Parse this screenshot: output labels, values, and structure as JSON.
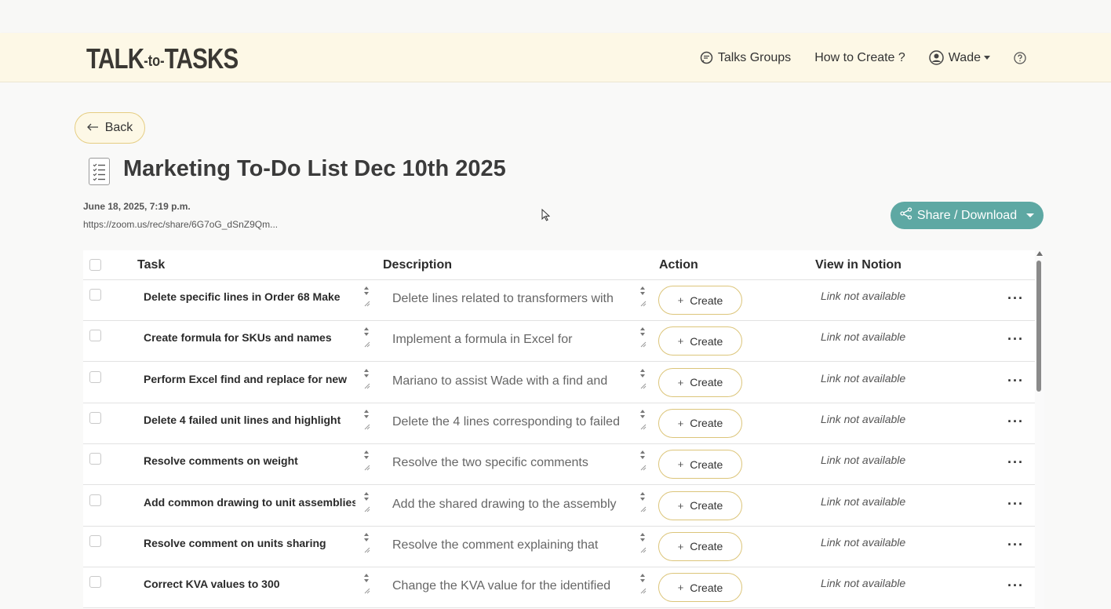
{
  "header": {
    "logo_main": "TALK",
    "logo_mid": "-to-",
    "logo_end": "TASKS",
    "nav": {
      "talks_groups": "Talks Groups",
      "how_to_create": "How to Create ?",
      "user": "Wade"
    }
  },
  "page": {
    "back_label": "Back",
    "title": "Marketing To-Do List Dec 10th 2025",
    "date": "June 18, 2025, 7:19 p.m.",
    "link": "https://zoom.us/rec/share/6G7oG_dSnZ9Qm...",
    "share_label": "Share / Download"
  },
  "table": {
    "columns": {
      "task": "Task",
      "description": "Description",
      "action": "Action",
      "notion": "View in Notion"
    },
    "create_label": "Create",
    "notion_empty": "Link not available",
    "rows": [
      {
        "task": "Delete specific lines in Order 68 Make",
        "description": "Delete lines related to transformers with"
      },
      {
        "task": "Create formula for SKUs and names",
        "description": "Implement a formula in Excel for"
      },
      {
        "task": "Perform Excel find and replace for new",
        "description": "Mariano to assist Wade with a find and"
      },
      {
        "task": "Delete 4 failed unit lines and highlight",
        "description": "Delete the 4 lines corresponding to failed"
      },
      {
        "task": "Resolve comments on weight",
        "description": "Resolve the two specific comments"
      },
      {
        "task": "Add common drawing to unit assemblies",
        "description": "Add the shared drawing to the assembly"
      },
      {
        "task": "Resolve comment on units sharing",
        "description": "Resolve the comment explaining that"
      },
      {
        "task": "Correct KVA values to 300",
        "description": "Change the KVA value for the identified"
      }
    ]
  },
  "colors": {
    "header_bg": "#fdf8e6",
    "accent_border": "#dcc57a",
    "share_bg": "#5ea8a3"
  }
}
